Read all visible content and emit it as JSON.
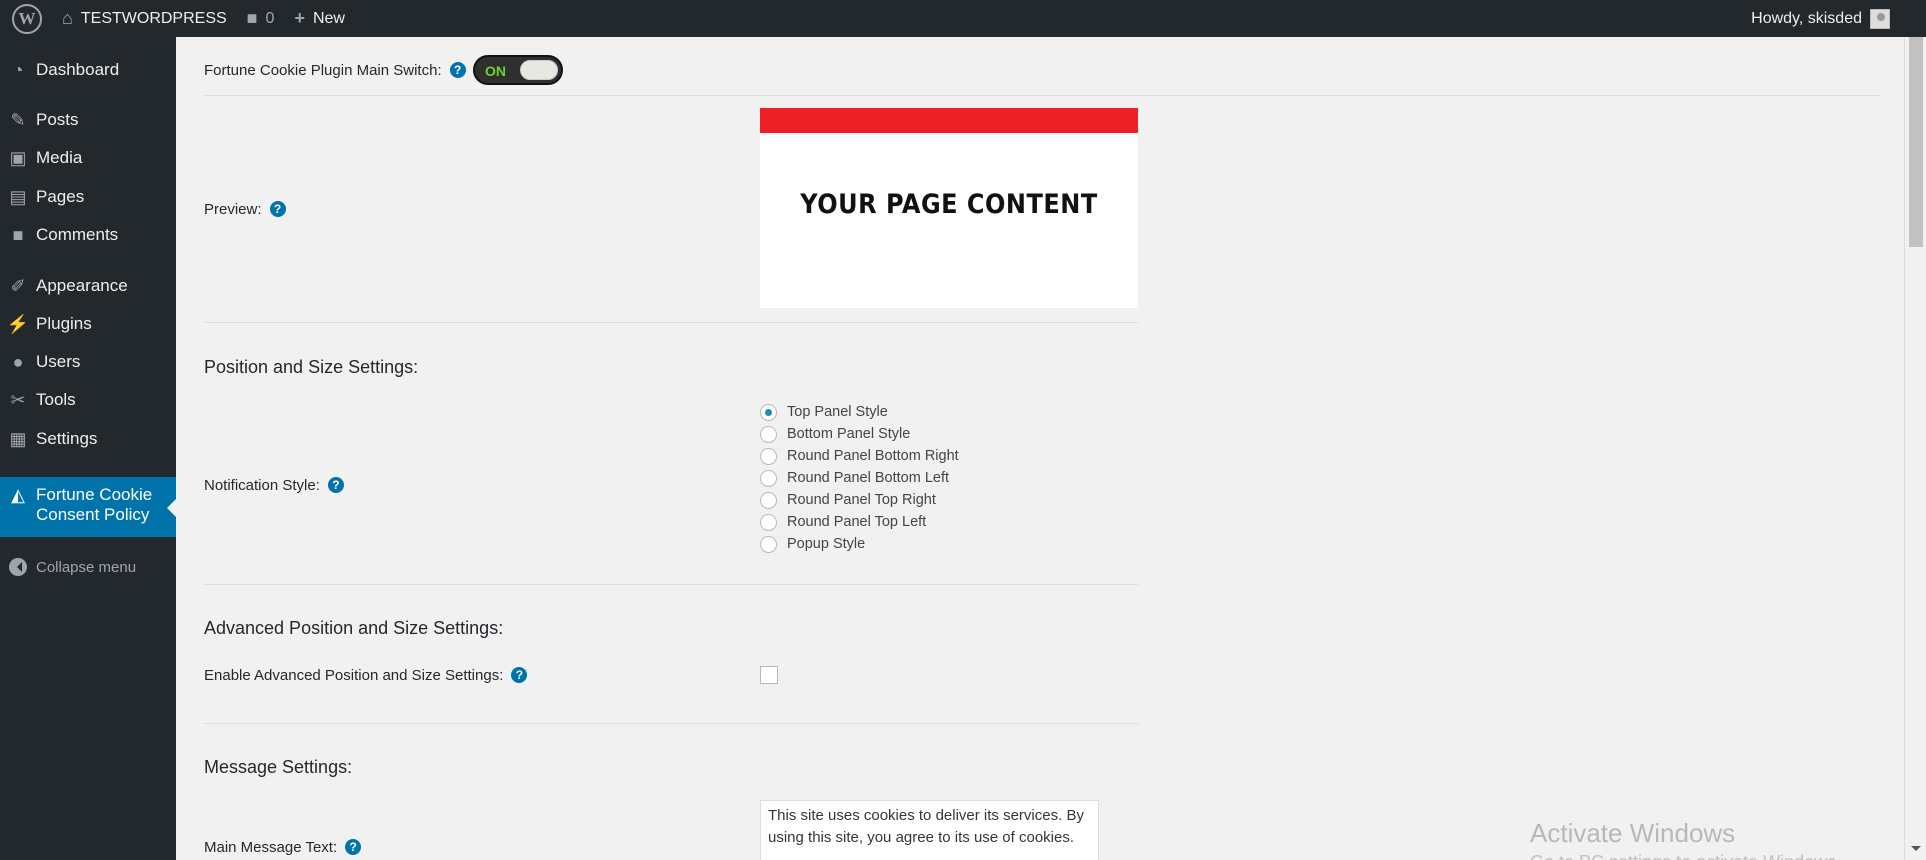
{
  "admin_bar": {
    "site_name": "TESTWORDPRESS",
    "comments_count": "0",
    "new_label": "New",
    "greeting": "Howdy, skisded"
  },
  "sidebar": {
    "items": [
      {
        "label": "Dashboard",
        "icon": "dashboard-icon"
      },
      {
        "label": "Posts",
        "icon": "pushpin-icon"
      },
      {
        "label": "Media",
        "icon": "media-icon"
      },
      {
        "label": "Pages",
        "icon": "pages-icon"
      },
      {
        "label": "Comments",
        "icon": "comment-icon"
      },
      {
        "label": "Appearance",
        "icon": "paintbrush-icon"
      },
      {
        "label": "Plugins",
        "icon": "plugin-icon"
      },
      {
        "label": "Users",
        "icon": "user-icon"
      },
      {
        "label": "Tools",
        "icon": "wrench-icon"
      },
      {
        "label": "Settings",
        "icon": "settings-icon"
      },
      {
        "label": "Fortune Cookie Consent Policy",
        "icon": "fortune-cookie-icon",
        "current": true
      }
    ],
    "collapse_label": "Collapse menu"
  },
  "main": {
    "main_switch_label": "Fortune Cookie Plugin Main Switch:",
    "main_switch_state": "ON",
    "preview_label": "Preview:",
    "preview_content": "YOUR PAGE CONTENT",
    "position_section_title": "Position and Size Settings:",
    "notification_style_label": "Notification Style:",
    "notification_styles": [
      {
        "label": "Top Panel Style",
        "checked": true
      },
      {
        "label": "Bottom Panel Style",
        "checked": false
      },
      {
        "label": "Round Panel Bottom Right",
        "checked": false
      },
      {
        "label": "Round Panel Bottom Left",
        "checked": false
      },
      {
        "label": "Round Panel Top Right",
        "checked": false
      },
      {
        "label": "Round Panel Top Left",
        "checked": false
      },
      {
        "label": "Popup Style",
        "checked": false
      }
    ],
    "advanced_section_title": "Advanced Position and Size Settings:",
    "enable_advanced_label": "Enable Advanced Position and Size Settings:",
    "enable_advanced_checked": false,
    "message_section_title": "Message Settings:",
    "main_message_label": "Main Message Text:",
    "main_message_value": "This site uses cookies to deliver its services. By using this site, you agree to its use of cookies."
  },
  "watermark": {
    "line1": "Activate Windows",
    "line2": "Go to PC settings to activate Windows."
  },
  "colors": {
    "admin_bar_bg": "#23282d",
    "accent": "#0073aa",
    "preview_bar": "#ee2128",
    "toggle_on": "#6cd22c"
  }
}
